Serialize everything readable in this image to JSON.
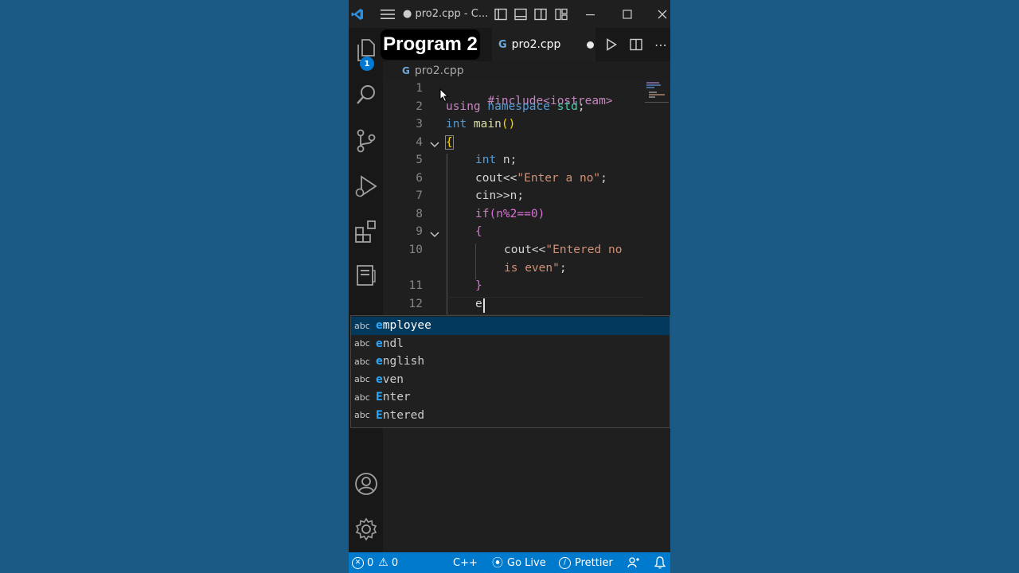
{
  "window": {
    "title": "● pro2.cpp - C...",
    "program_label": "Program 2"
  },
  "activity_bar": {
    "explorer_badge": "1",
    "icons": [
      "explorer-icon",
      "search-icon",
      "source-control-icon",
      "run-debug-icon",
      "extensions-icon",
      "remote-icon",
      "account-icon",
      "settings-gear-icon"
    ]
  },
  "tab": {
    "label": "pro2.cpp",
    "icon": "cpp-icon"
  },
  "breadcrumb": {
    "file": "pro2.cpp"
  },
  "editor": {
    "line_numbers": [
      "1",
      "2",
      "3",
      "4",
      "5",
      "6",
      "7",
      "8",
      "9",
      "10",
      "11",
      "12"
    ],
    "lines": {
      "l1": "#include<iostream>",
      "l2a": "using",
      "l2b": " namespace",
      "l2c": " std",
      "l2d": ";",
      "l3a": "int",
      "l3b": " main",
      "l3c": "()",
      "l4": "{",
      "l5a": "int",
      "l5b": " n;",
      "l6a": "cout<<",
      "l6b": "\"Enter a no\"",
      "l6c": ";",
      "l7": "cin>>n;",
      "l8a": "if",
      "l8b": "(n%2==0)",
      "l9": "{",
      "l10a": "cout<<",
      "l10b": "\"Entered no",
      "l10c": "is even\"",
      "l10d": ";",
      "l11": "}",
      "l12": "e"
    }
  },
  "suggestions": [
    {
      "kind": "abc",
      "match": "e",
      "rest": "mployee",
      "selected": true
    },
    {
      "kind": "abc",
      "match": "e",
      "rest": "ndl",
      "selected": false
    },
    {
      "kind": "abc",
      "match": "e",
      "rest": "nglish",
      "selected": false
    },
    {
      "kind": "abc",
      "match": "e",
      "rest": "ven",
      "selected": false
    },
    {
      "kind": "abc",
      "match": "E",
      "rest": "nter",
      "selected": false
    },
    {
      "kind": "abc",
      "match": "E",
      "rest": "ntered",
      "selected": false
    }
  ],
  "status_bar": {
    "errors": "0",
    "warnings": "0",
    "language": "C++",
    "go_live": "Go Live",
    "prettier": "Prettier"
  },
  "colors": {
    "background": "#1b5a85",
    "status_bar": "#007acc",
    "suggest_selected": "#04395e"
  }
}
